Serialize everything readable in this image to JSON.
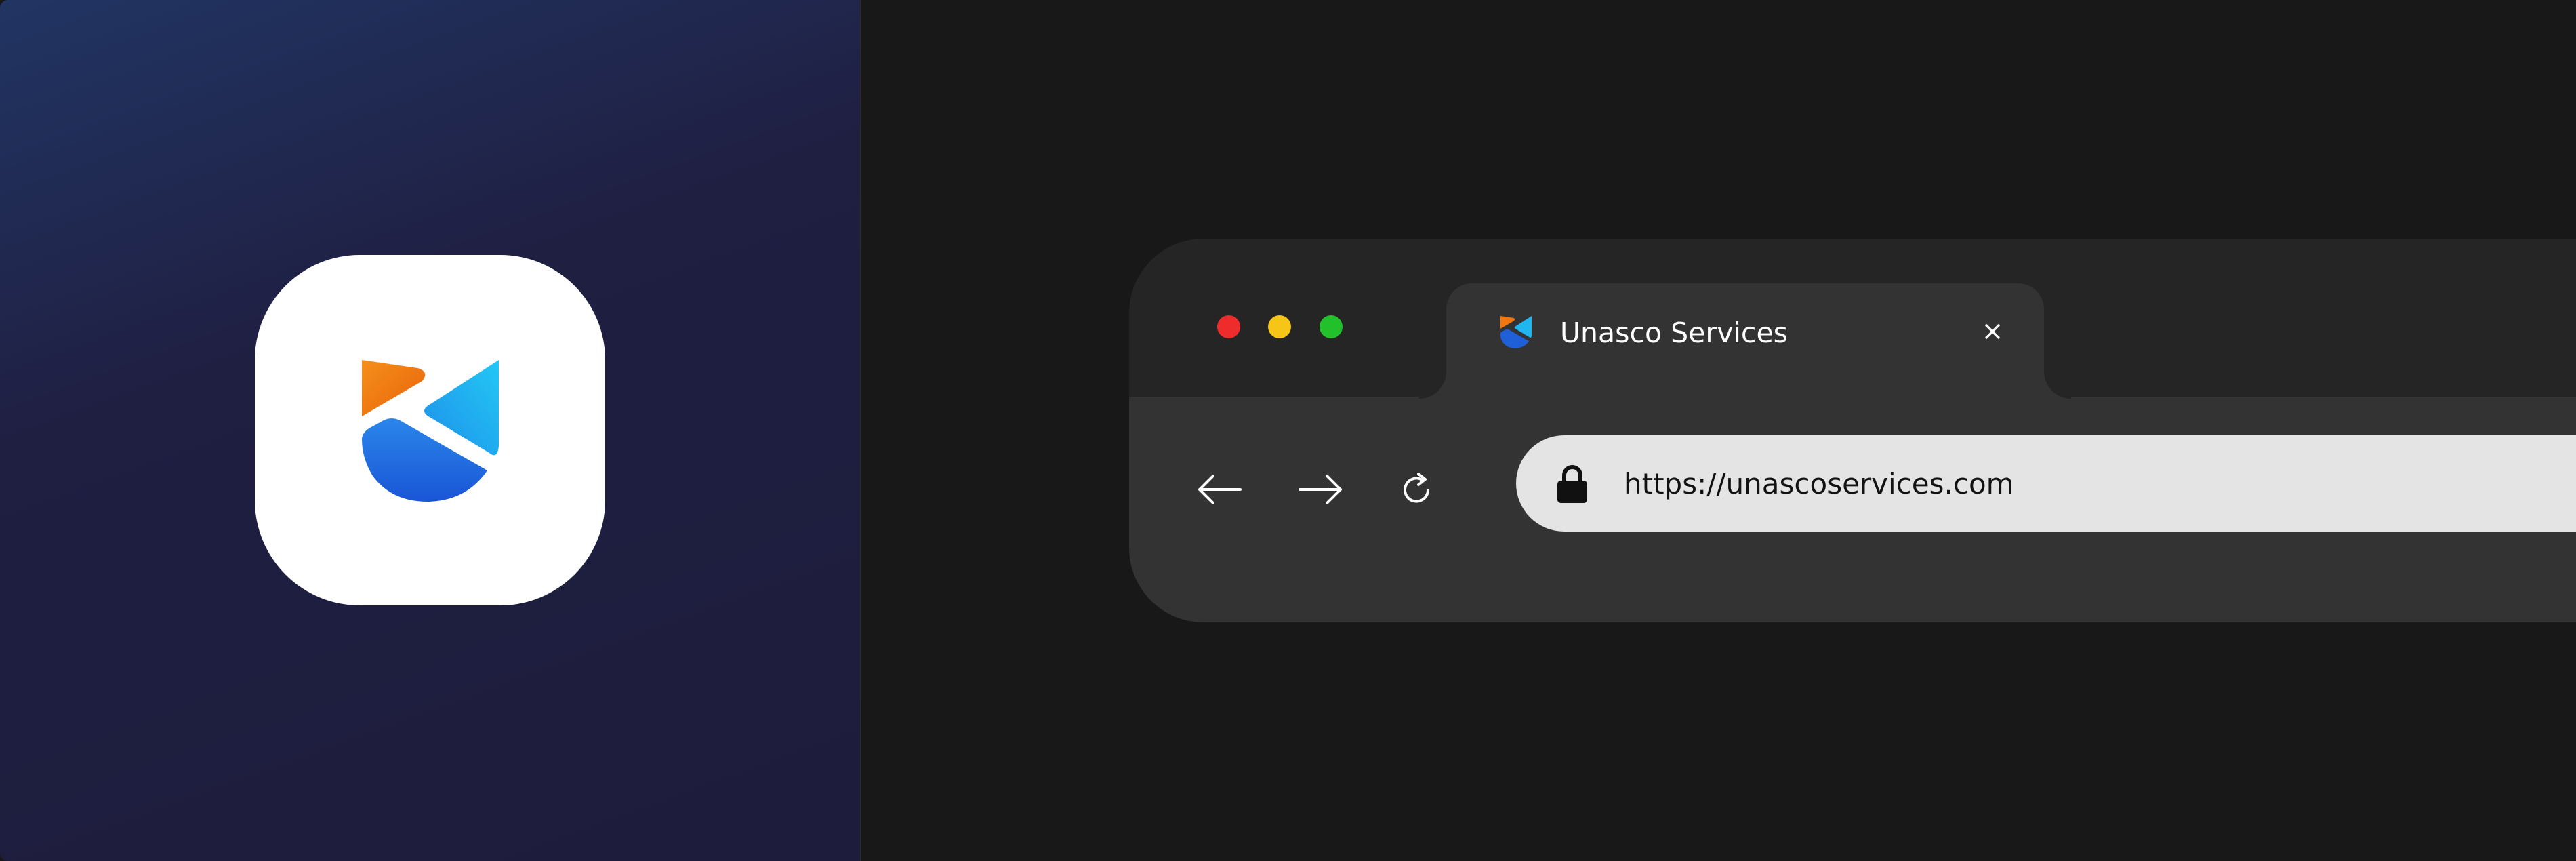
{
  "colors": {
    "left_panel_gradient": [
      "#213563",
      "#1d1c3c"
    ],
    "right_background": "#181818",
    "tabstrip": "#252525",
    "toolbar": "#333333",
    "urlbar": "#e4e4e4",
    "traffic_red": "#ee2c2c",
    "traffic_yellow": "#f5c518",
    "traffic_green": "#22c12b",
    "logo_orange": "#f0770f",
    "logo_light_blue": "#20b6f0",
    "logo_dark_blue": "#1f5fd8"
  },
  "app_icon": {
    "name": "unasco-logo-icon"
  },
  "browser": {
    "tab": {
      "favicon": "unasco-favicon-icon",
      "title": "Unasco Services",
      "close_icon": "close-icon"
    },
    "nav": {
      "back_icon": "arrow-left-icon",
      "forward_icon": "arrow-right-icon",
      "reload_icon": "reload-icon"
    },
    "address_bar": {
      "lock_icon": "lock-icon",
      "url": "https://unascoservices.com"
    }
  }
}
